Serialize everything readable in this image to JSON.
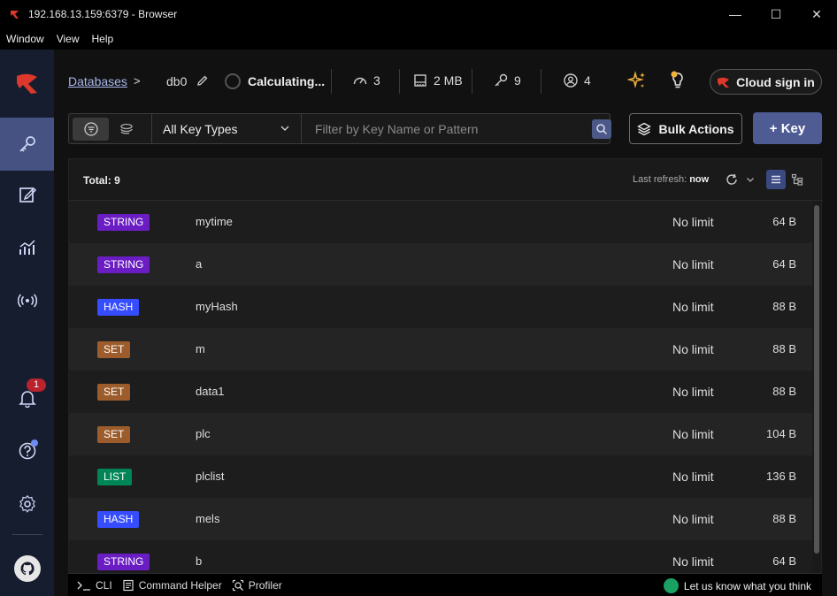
{
  "window": {
    "title": "192.168.13.159:6379 - Browser",
    "controls": {
      "minimize": "—",
      "maximize": "☐",
      "close": "✕"
    }
  },
  "menu": [
    "Window",
    "View",
    "Help"
  ],
  "sidebar": {
    "notification_count": "1"
  },
  "header": {
    "breadcrumb_link": "Databases",
    "breadcrumb_sep": ">",
    "db_name": "db0",
    "status": "Calculating...",
    "clients": "3",
    "memory": "2 MB",
    "keys": "9",
    "connections": "4",
    "cloud_label": "Cloud sign in"
  },
  "filter": {
    "type_select": "All Key Types",
    "search_placeholder": "Filter by Key Name or Pattern",
    "bulk_label": "Bulk Actions",
    "add_key_label": "+ Key"
  },
  "table": {
    "total_label": "Total: 9",
    "refresh_label": "Last refresh: ",
    "refresh_value": "now",
    "rows": [
      {
        "type": "STRING",
        "color": "#6a1dc2",
        "name": "mytime",
        "ttl": "No limit",
        "size": "64 B"
      },
      {
        "type": "STRING",
        "color": "#6a1dc2",
        "name": "a",
        "ttl": "No limit",
        "size": "64 B"
      },
      {
        "type": "HASH",
        "color": "#364cff",
        "name": "myHash",
        "ttl": "No limit",
        "size": "88 B"
      },
      {
        "type": "SET",
        "color": "#9c5c2b",
        "name": "m",
        "ttl": "No limit",
        "size": "88 B"
      },
      {
        "type": "SET",
        "color": "#9c5c2b",
        "name": "data1",
        "ttl": "No limit",
        "size": "88 B"
      },
      {
        "type": "SET",
        "color": "#9c5c2b",
        "name": "plc",
        "ttl": "No limit",
        "size": "104 B"
      },
      {
        "type": "LIST",
        "color": "#008556",
        "name": "plclist",
        "ttl": "No limit",
        "size": "136 B"
      },
      {
        "type": "HASH",
        "color": "#364cff",
        "name": "mels",
        "ttl": "No limit",
        "size": "88 B"
      },
      {
        "type": "STRING",
        "color": "#6a1dc2",
        "name": "b",
        "ttl": "No limit",
        "size": "64 B"
      }
    ]
  },
  "bottombar": {
    "cli": "CLI",
    "command_helper": "Command Helper",
    "profiler": "Profiler",
    "feedback": "Let us know what you think"
  },
  "colors": {
    "accent": "#465282",
    "brand": "#dc382c"
  }
}
